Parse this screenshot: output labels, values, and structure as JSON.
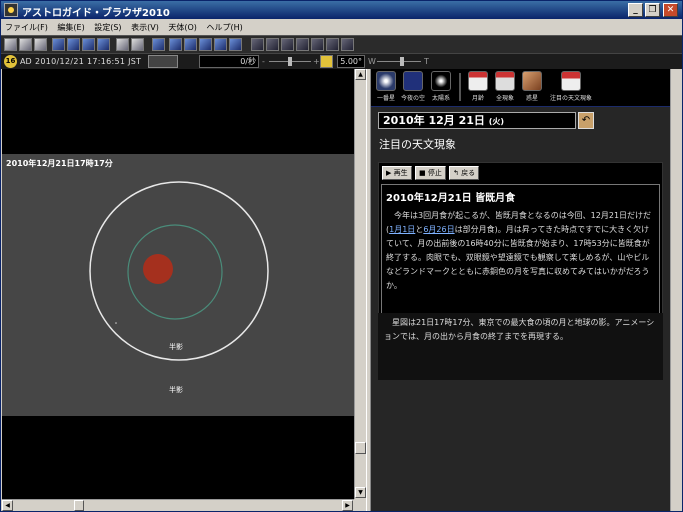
{
  "window": {
    "title": "アストロガイド・ブラウザ2010",
    "buttons": {
      "minimize": "_",
      "maximize": "❐",
      "close": "✕"
    }
  },
  "menu": [
    "ファイル(F)",
    "編集(E)",
    "設定(S)",
    "表示(V)",
    "天体(O)",
    "ヘルプ(H)"
  ],
  "toolbar2": {
    "badge": "16",
    "era": "AD",
    "datetime": "2010/12/21 17:16:51 JST",
    "rate": "0/秒",
    "degree": "5.00°",
    "w_label": "W",
    "t_label": "T",
    "plus": "+",
    "minus": "-"
  },
  "sky": {
    "datetime_label": "2010年12月21日17時17分",
    "inner_label": "半影",
    "outer_label": "半影",
    "moon_color": "#a5301e"
  },
  "nav": {
    "items": [
      {
        "label": "一番星",
        "icon": "star-icon"
      },
      {
        "label": "今夜の空",
        "icon": "clock-icon"
      },
      {
        "label": "太陽系",
        "icon": "planets-icon"
      },
      {
        "label": "月齢",
        "icon": "moon-calendar-icon"
      },
      {
        "label": "全現象",
        "icon": "phenomena-icon"
      },
      {
        "label": "惑星",
        "icon": "planet-icon"
      },
      {
        "label": "注目の天文現象",
        "icon": "alert-icon"
      }
    ]
  },
  "panel": {
    "date": "2010年 12月 21日",
    "weekday": "(火)",
    "heading": "注目の天文現象",
    "controls": {
      "play": "▶ 再生",
      "stop": "■ 停止",
      "back": "↰ 戻る"
    },
    "article_title": "2010年12月21日 皆既月食",
    "body_pre": "今年は3回月食が起こるが、皆既月食となるのは今回、12月21日だけだ(",
    "link1": "1月1日",
    "body_and": "と",
    "link2": "6月26日",
    "body_post": "は部分月食)。月は昇ってきた時点ですでに大きく欠けていて、月の出前後の16時40分に皆既食が始まり、17時53分に皆既食が終了する。肉眼でも、双眼鏡や望遠鏡でも観察して楽しめるが、山やビルなどランドマークとともに赤銅色の月を写真に収めてみてはいかがだろうか。",
    "caption": "星図は21日17時17分、東京での最大食の頃の月と地球の影。アニメーションでは、月の出から月食の終了までを再現する。"
  }
}
